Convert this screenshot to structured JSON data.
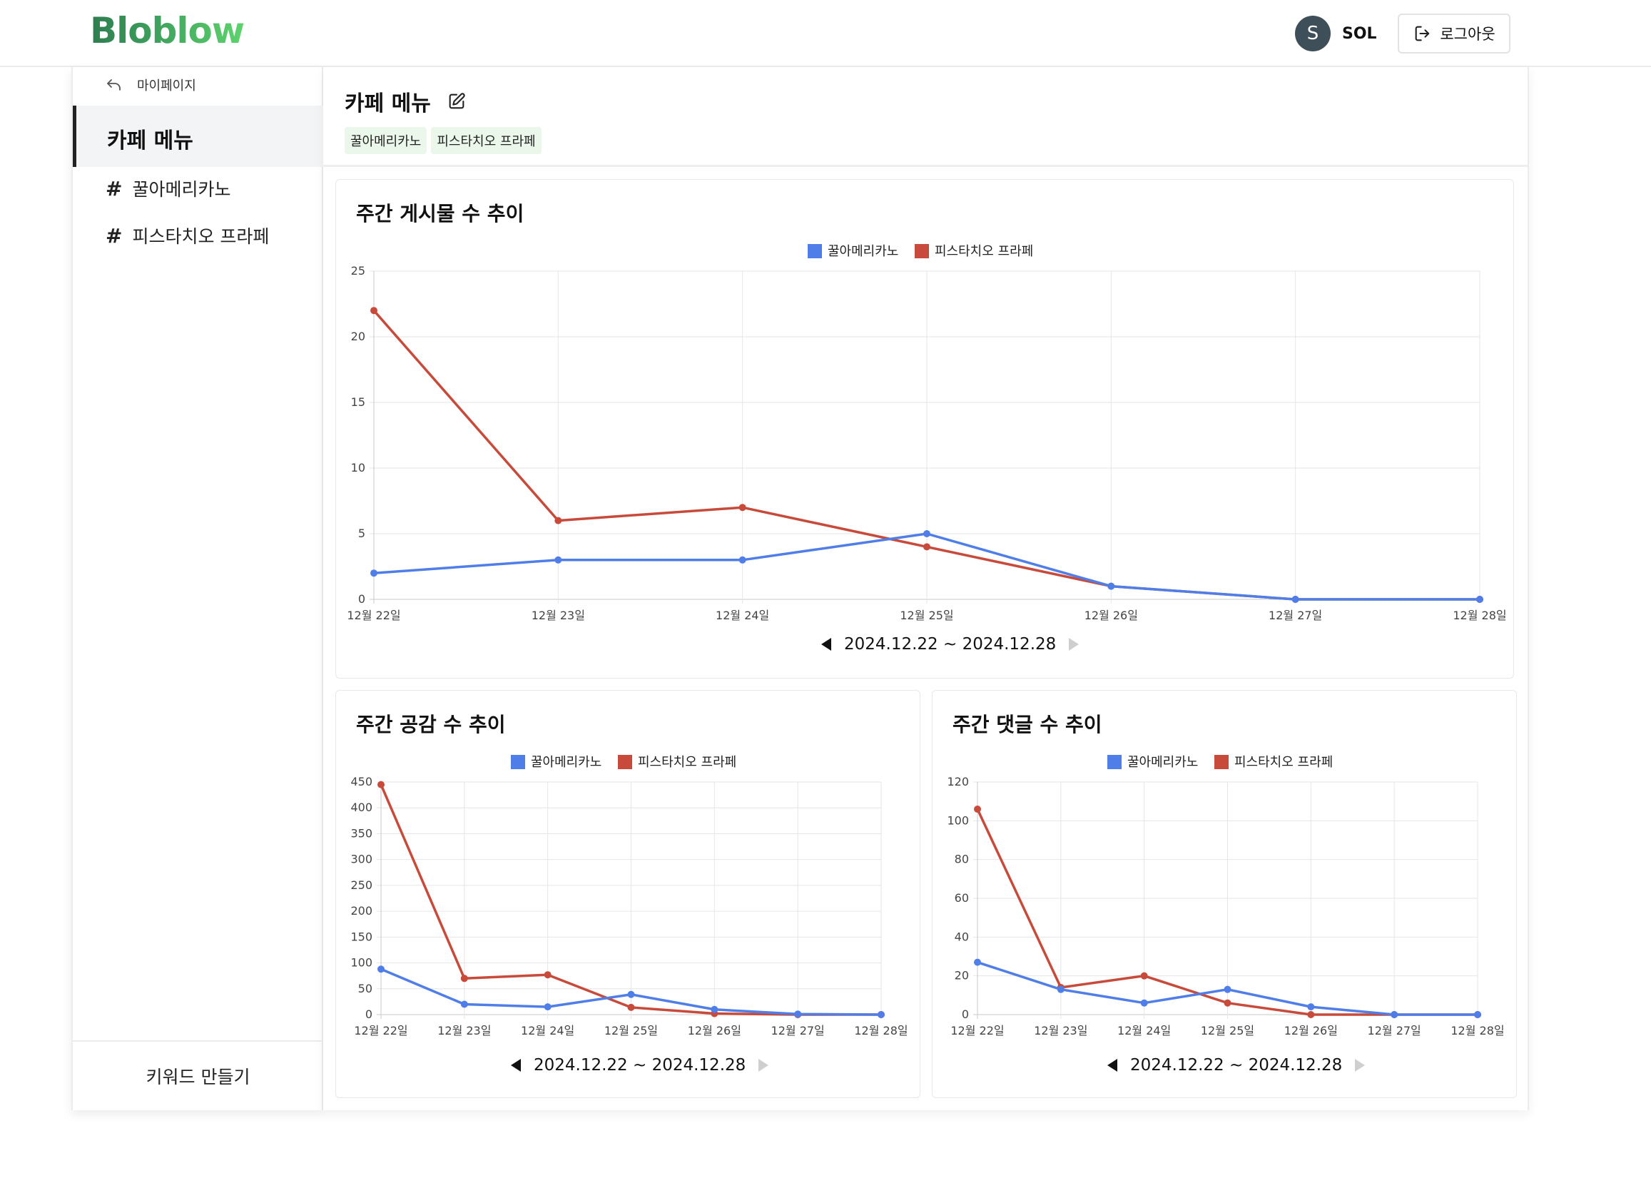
{
  "header": {
    "logo": "Bloblow",
    "user_initial": "S",
    "user_name": "SOL",
    "logout_label": "로그아웃"
  },
  "sidebar": {
    "back_label": "마이페이지",
    "active_label": "카페 메뉴",
    "items": [
      {
        "hash": "#",
        "label": "꿀아메리카노"
      },
      {
        "hash": "#",
        "label": "피스타치오 프라페"
      }
    ],
    "bottom_button": "키워드 만들기"
  },
  "main": {
    "title": "카페 메뉴",
    "tags": [
      "꿀아메리카노",
      "피스타치오 프라페"
    ]
  },
  "colors": {
    "series1": "#4f7ee8",
    "series2": "#c84a3a"
  },
  "chart_data": [
    {
      "type": "line",
      "title": "주간 게시물 수 추이",
      "categories": [
        "12월 22일",
        "12월 23일",
        "12월 24일",
        "12월 25일",
        "12월 26일",
        "12월 27일",
        "12월 28일"
      ],
      "series": [
        {
          "name": "꿀아메리카노",
          "values": [
            2,
            3,
            3,
            5,
            1,
            0,
            0
          ]
        },
        {
          "name": "피스타치오 프라페",
          "values": [
            22,
            6,
            7,
            4,
            1,
            0,
            0
          ]
        }
      ],
      "ylim": [
        0,
        25
      ],
      "yticks": [
        0,
        5,
        10,
        15,
        20,
        25
      ],
      "legend": "top-center",
      "grid": true,
      "range_label": "2024.12.22 ~ 2024.12.28"
    },
    {
      "type": "line",
      "title": "주간 공감 수 추이",
      "categories": [
        "12월 22일",
        "12월 23일",
        "12월 24일",
        "12월 25일",
        "12월 26일",
        "12월 27일",
        "12월 28일"
      ],
      "series": [
        {
          "name": "꿀아메리카노",
          "values": [
            88,
            20,
            15,
            39,
            10,
            1,
            0
          ]
        },
        {
          "name": "피스타치오 프라페",
          "values": [
            445,
            70,
            77,
            14,
            2,
            0,
            0
          ]
        }
      ],
      "ylim": [
        0,
        450
      ],
      "yticks": [
        0,
        50,
        100,
        150,
        200,
        250,
        300,
        350,
        400,
        450
      ],
      "legend": "top-center",
      "grid": true,
      "range_label": "2024.12.22 ~ 2024.12.28"
    },
    {
      "type": "line",
      "title": "주간 댓글 수 추이",
      "categories": [
        "12월 22일",
        "12월 23일",
        "12월 24일",
        "12월 25일",
        "12월 26일",
        "12월 27일",
        "12월 28일"
      ],
      "series": [
        {
          "name": "꿀아메리카노",
          "values": [
            27,
            13,
            6,
            13,
            4,
            0,
            0
          ]
        },
        {
          "name": "피스타치오 프라페",
          "values": [
            106,
            14,
            20,
            6,
            0,
            0,
            0
          ]
        }
      ],
      "ylim": [
        0,
        120
      ],
      "yticks": [
        0,
        20,
        40,
        60,
        80,
        100,
        120
      ],
      "legend": "top-center",
      "grid": true,
      "range_label": "2024.12.22 ~ 2024.12.28"
    }
  ]
}
